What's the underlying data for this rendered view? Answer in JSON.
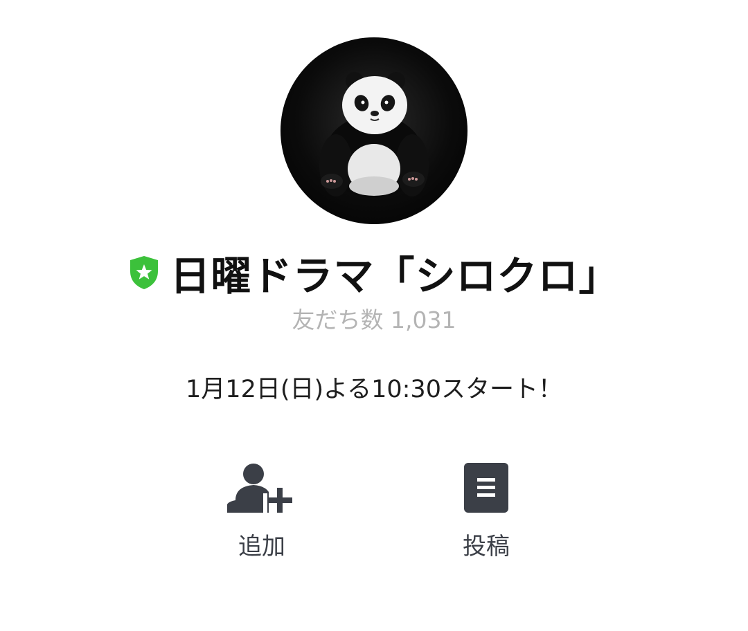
{
  "profile": {
    "avatar_icon": "panda-avatar",
    "badge_icon": "verified-shield-icon",
    "badge_color": "#3cc13b",
    "name": "日曜ドラマ「シロクロ」",
    "friends_count": "友だち数 1,031",
    "status_message": "1月12日(日)よる10:30スタート！"
  },
  "actions": [
    {
      "label": "追加",
      "icon": "add-friend-icon"
    },
    {
      "label": "投稿",
      "icon": "posts-icon"
    }
  ],
  "colors": {
    "icon": "#3b3f47",
    "muted_text": "#b4b4b4"
  }
}
